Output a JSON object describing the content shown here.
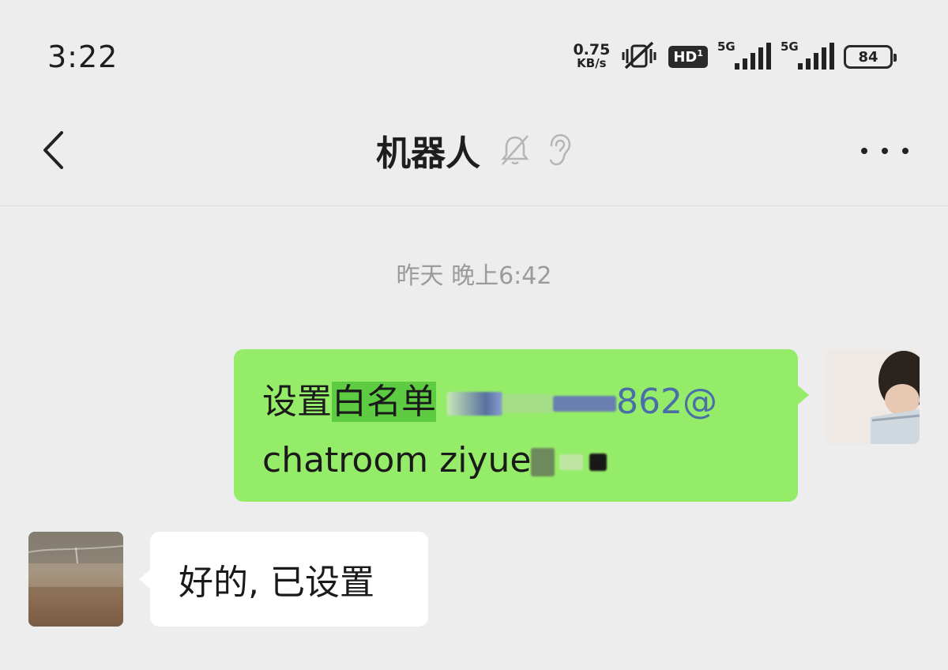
{
  "status_bar": {
    "time": "3:22",
    "net_speed_value": "0.75",
    "net_speed_unit": "KB/s",
    "hd_label": "HD",
    "sim1_tag": "5G",
    "sim2_tag": "5G",
    "battery": "84"
  },
  "header": {
    "title": "机器人",
    "mute_icon": "bell-slash-icon",
    "ear_icon": "ear-icon",
    "more_icon": "more-dots-icon"
  },
  "chat": {
    "timestamp": "昨天 晚上6:42",
    "sent_message": {
      "prefix": "设置",
      "highlight": "白名单",
      "masked_part_suffix": "862@",
      "line2": "chatroom ziyue"
    },
    "received_message": {
      "text": "好的, 已设置"
    }
  },
  "colors": {
    "background": "#ededed",
    "sent_bubble": "#95ec69",
    "received_bubble": "#ffffff",
    "highlight": "#5ecc43",
    "link": "#4a6ea8"
  }
}
